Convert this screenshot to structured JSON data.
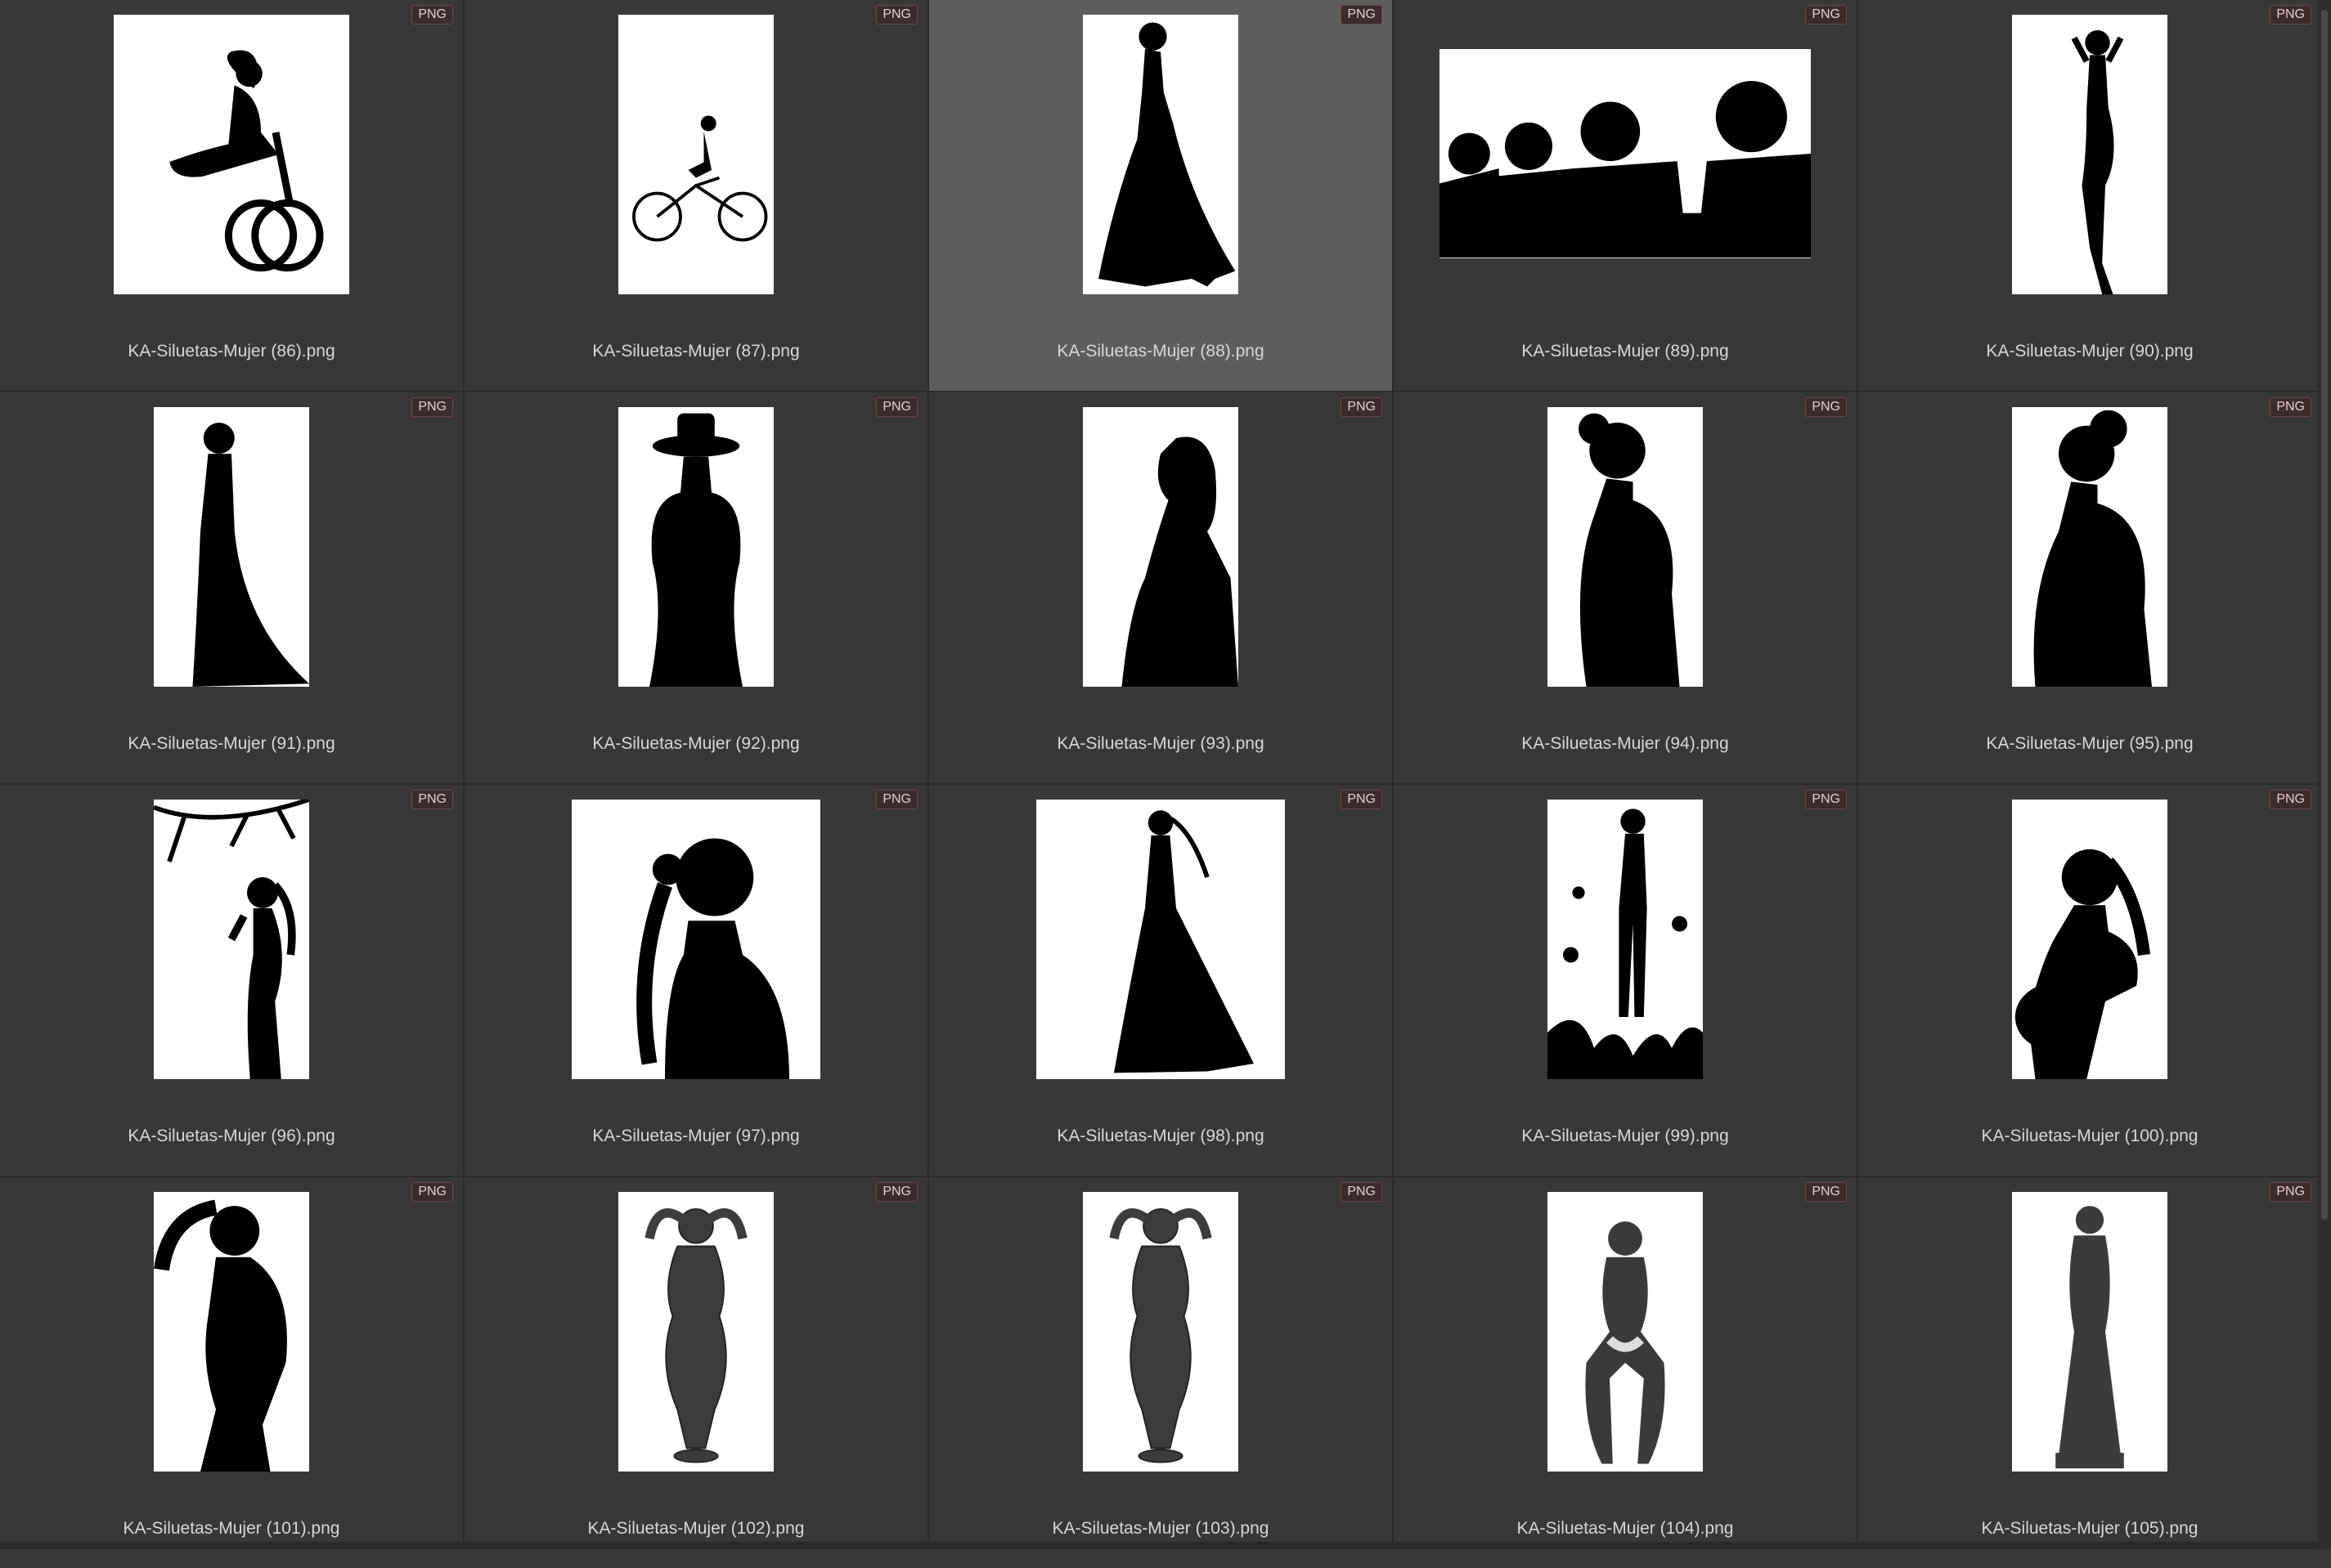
{
  "badge_label": "PNG",
  "selected_index": 2,
  "items": [
    {
      "file": "KA-Siluetas-Mujer (86).png",
      "thumb": "portrait-wide",
      "art": "bike-dress"
    },
    {
      "file": "KA-Siluetas-Mujer (87).png",
      "thumb": "portrait",
      "art": "bike-small"
    },
    {
      "file": "KA-Siluetas-Mujer (88).png",
      "thumb": "portrait",
      "art": "gown-side"
    },
    {
      "file": "KA-Siluetas-Mujer (89).png",
      "thumb": "landscape",
      "art": "headsets-group"
    },
    {
      "file": "KA-Siluetas-Mujer (90).png",
      "thumb": "portrait",
      "art": "posing"
    },
    {
      "file": "KA-Siluetas-Mujer (91).png",
      "thumb": "portrait",
      "art": "long-dress"
    },
    {
      "file": "KA-Siluetas-Mujer (92).png",
      "thumb": "portrait",
      "art": "hat-front"
    },
    {
      "file": "KA-Siluetas-Mujer (93).png",
      "thumb": "portrait",
      "art": "looking-up"
    },
    {
      "file": "KA-Siluetas-Mujer (94).png",
      "thumb": "portrait",
      "art": "bun-profile"
    },
    {
      "file": "KA-Siluetas-Mujer (95).png",
      "thumb": "portrait",
      "art": "bun-profile-2"
    },
    {
      "file": "KA-Siluetas-Mujer (96).png",
      "thumb": "portrait",
      "art": "branch-ponytail"
    },
    {
      "file": "KA-Siluetas-Mujer (97).png",
      "thumb": "portrait-wide",
      "art": "braid"
    },
    {
      "file": "KA-Siluetas-Mujer (98).png",
      "thumb": "portrait-wide",
      "art": "ponytail-gown"
    },
    {
      "file": "KA-Siluetas-Mujer (99).png",
      "thumb": "portrait",
      "art": "flowers"
    },
    {
      "file": "KA-Siluetas-Mujer (100).png",
      "thumb": "portrait",
      "art": "pregnant"
    },
    {
      "file": "KA-Siluetas-Mujer (101).png",
      "thumb": "portrait",
      "art": "hand-head"
    },
    {
      "file": "KA-Siluetas-Mujer (102).png",
      "thumb": "portrait",
      "art": "statue"
    },
    {
      "file": "KA-Siluetas-Mujer (103).png",
      "thumb": "portrait",
      "art": "statue-2"
    },
    {
      "file": "KA-Siluetas-Mujer (104).png",
      "thumb": "portrait",
      "art": "sitting"
    },
    {
      "file": "KA-Siluetas-Mujer (105).png",
      "thumb": "portrait",
      "art": "statue-gown"
    }
  ]
}
